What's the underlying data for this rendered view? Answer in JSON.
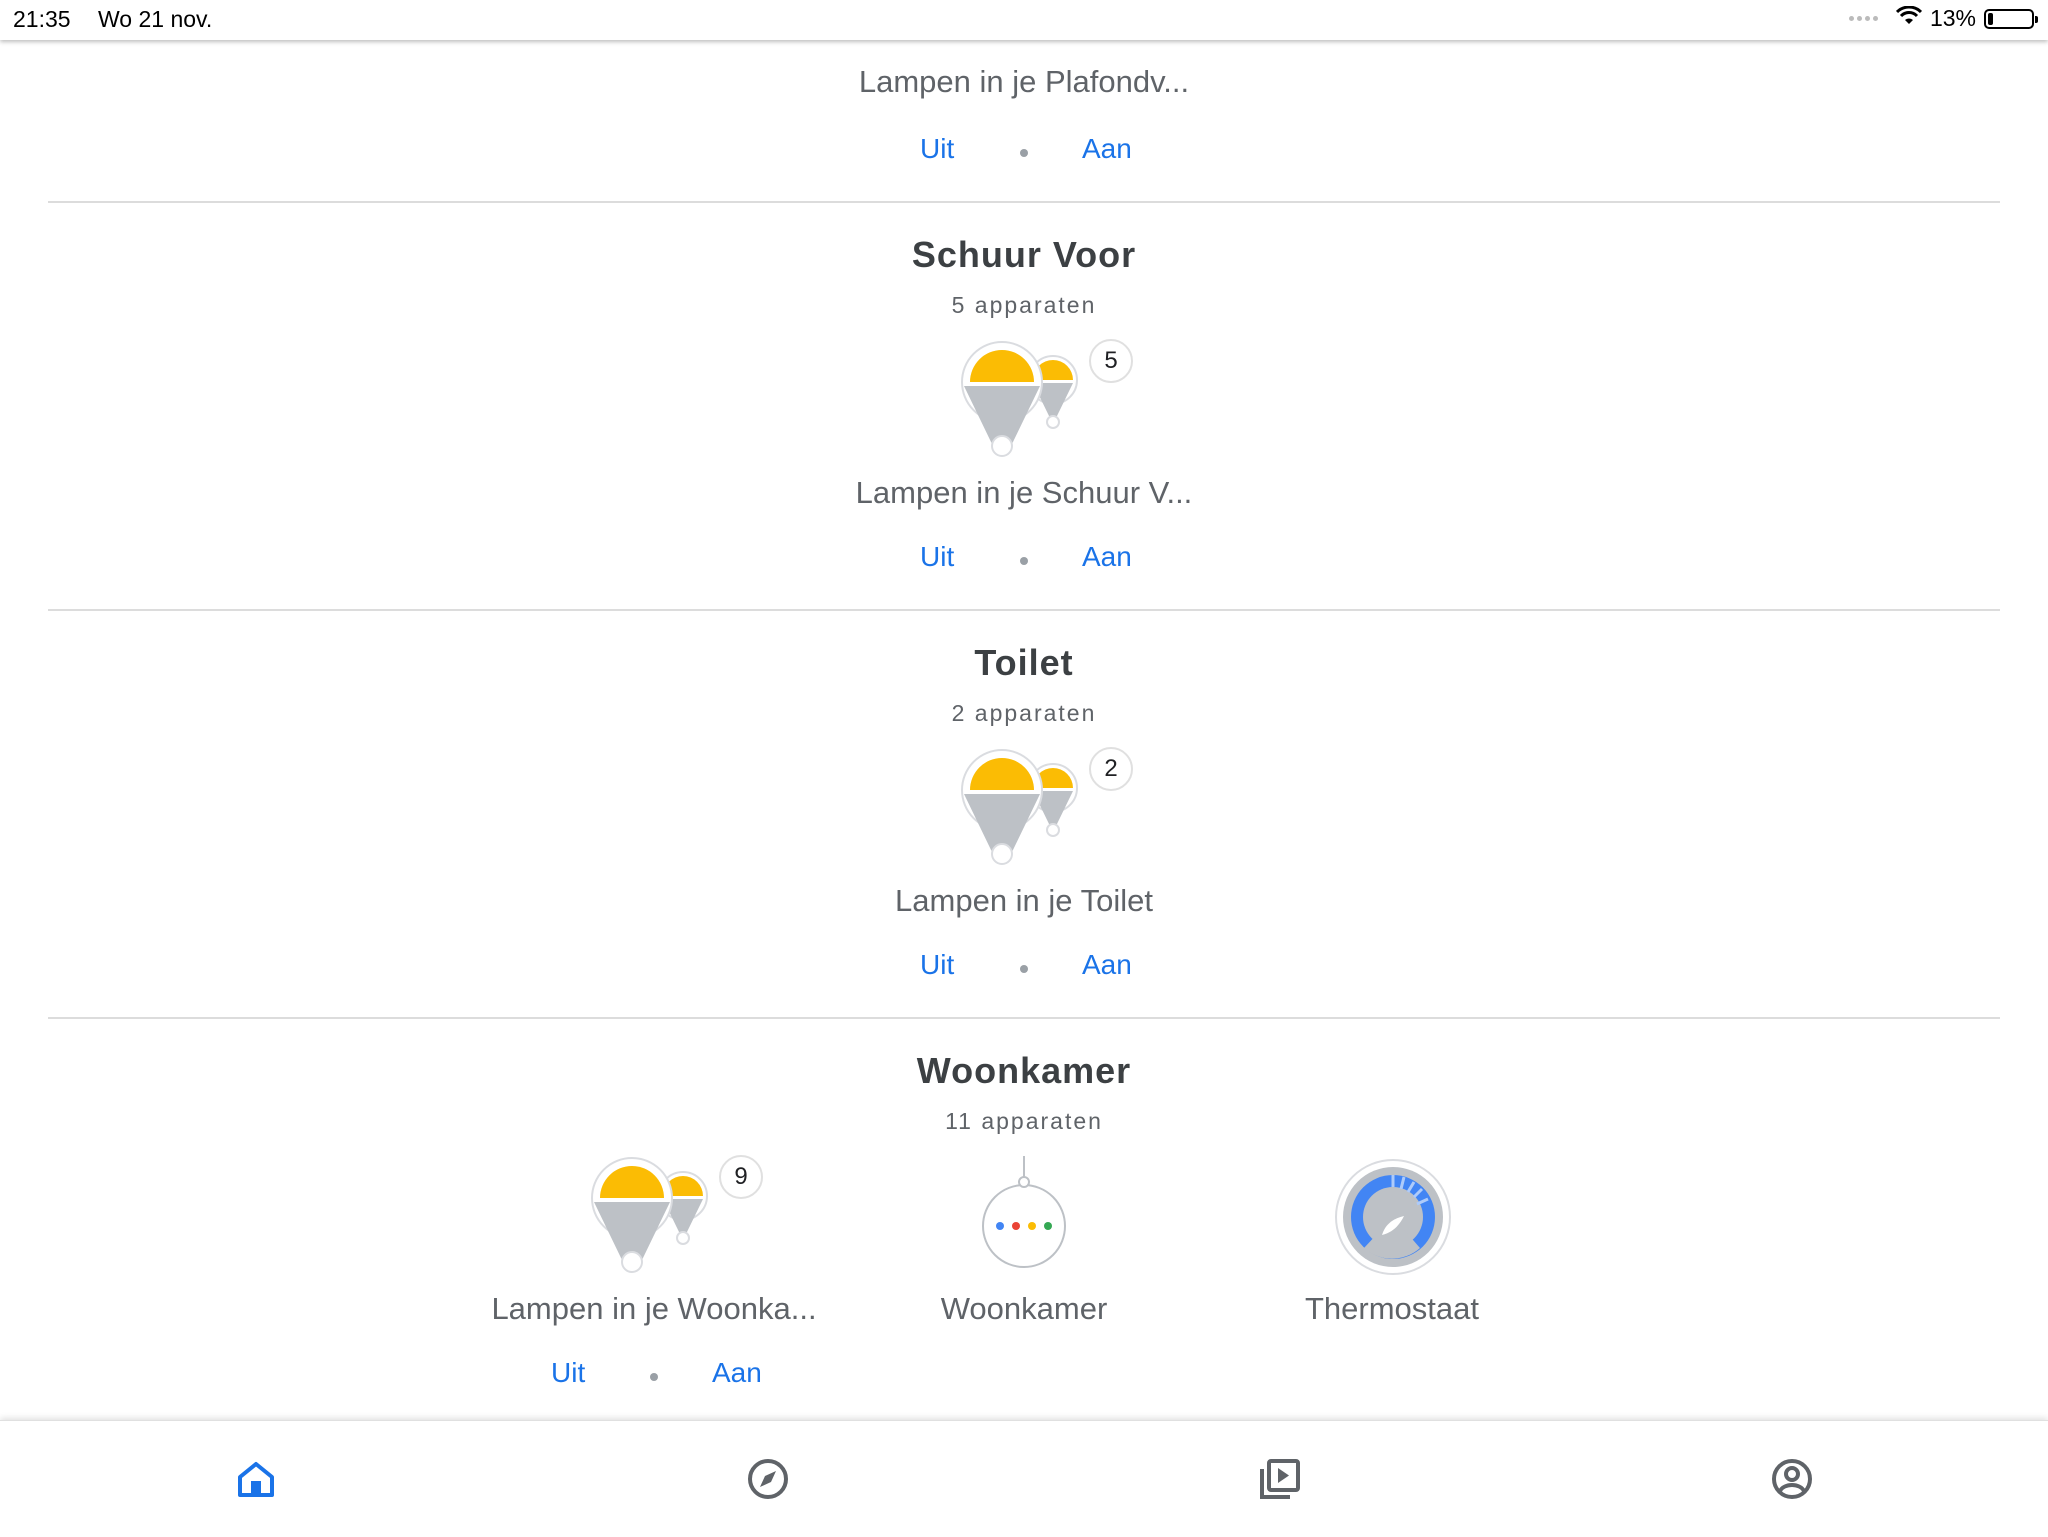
{
  "status_bar": {
    "time": "21:35",
    "date": "Wo 21 nov.",
    "battery": "13%",
    "battery_level": 0.13
  },
  "rooms": [
    {
      "device_label": "Lampen in je Plafondv...",
      "off_label": "Uit",
      "on_label": "Aan"
    },
    {
      "title": "Schuur Voor",
      "count": "5 apparaten",
      "badge": "5",
      "device_label": "Lampen in je Schuur V...",
      "off_label": "Uit",
      "on_label": "Aan"
    },
    {
      "title": "Toilet",
      "count": "2 apparaten",
      "badge": "2",
      "device_label": "Lampen in je Toilet",
      "off_label": "Uit",
      "on_label": "Aan"
    },
    {
      "title": "Woonkamer",
      "count": "11 apparaten",
      "badge": "9",
      "device_label": "Lampen in je Woonka...",
      "off_label": "Uit",
      "on_label": "Aan",
      "speaker_label": "Woonkamer",
      "thermostat_label": "Thermostaat"
    }
  ],
  "nav": {
    "items": [
      "home-icon",
      "discover-icon",
      "media-icon",
      "account-icon"
    ],
    "active": "home-icon"
  },
  "colors": {
    "accent": "#1a73e8",
    "bulb_yellow": "#fbbc04",
    "bulb_gray": "#bdc1c6",
    "thermostat_blue": "#4285f4"
  }
}
